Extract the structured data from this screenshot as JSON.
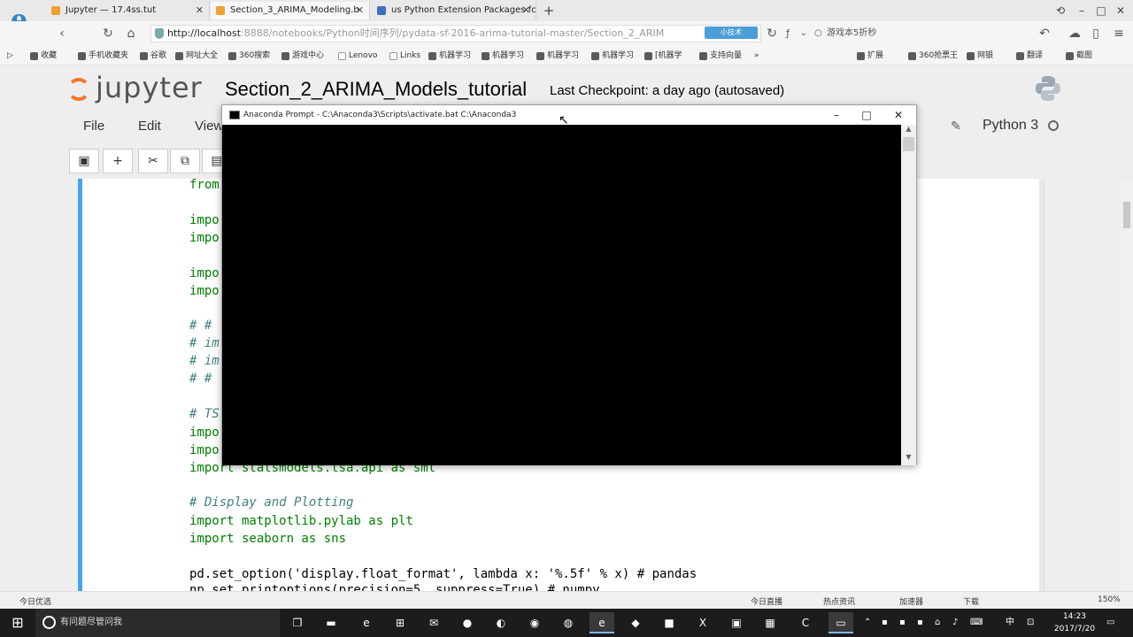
{
  "browser": {
    "tabs": [
      {
        "label": "Jupyter — 17.4ss.tut"
      },
      {
        "label": "Section_3_ARIMA_Modeling.b"
      },
      {
        "label": "us Python Extension Packages fc"
      }
    ],
    "new_tab": "+",
    "url_host": "http://localhost",
    "url_rest": ":8888/notebooks/Python时间序列/pydata-sf-2016-arima-tutorial-master/Section_2_ARIM",
    "url_badge": "小技术",
    "search_text": "游戏本5折秒",
    "bookmarks": [
      "收藏",
      "手机收藏夹",
      "谷歌",
      "网址大全",
      "360搜索",
      "游戏中心",
      "Lenovo",
      "Links",
      "机器学习",
      "机器学习",
      "机器学习",
      "机器学习",
      "[机器学",
      "支持向量"
    ],
    "bookmark_right": [
      "扩展",
      "360抢票王",
      "网银",
      "翻译",
      "截图"
    ]
  },
  "jupyter": {
    "logo_text": "jupyter",
    "notebook_title": "Section_2_ARIMA_Models_tutorial",
    "checkpoint": "Last Checkpoint: a day ago (autosaved)",
    "menu": [
      "File",
      "Edit",
      "View"
    ],
    "kernel": "Python 3",
    "toolbar": {
      "save": "💾",
      "add": "+",
      "cut": "✂",
      "copy": "⧉",
      "paste": "📋"
    },
    "code_lines": [
      {
        "text": "from",
        "type": "kw"
      },
      {
        "text": "impo",
        "type": "kw"
      },
      {
        "text": "impo",
        "type": "kw"
      },
      {
        "text": "impo",
        "type": "kw"
      },
      {
        "text": "impo",
        "type": "kw"
      },
      {
        "text": "# #",
        "type": "comment"
      },
      {
        "text": "# im",
        "type": "comment"
      },
      {
        "text": "# im",
        "type": "comment"
      },
      {
        "text": "# #",
        "type": "comment"
      },
      {
        "text": "# TS",
        "type": "comment"
      },
      {
        "text": "impo",
        "type": "kw"
      },
      {
        "text": "impo",
        "type": "kw"
      },
      {
        "text": "import statsmodels.tsa.api as smt",
        "type": "kw"
      },
      {
        "text": "# Display and Plotting",
        "type": "comment"
      },
      {
        "text": "import matplotlib.pylab as plt",
        "type": "kw"
      },
      {
        "text": "import seaborn as sns",
        "type": "kw"
      },
      {
        "text": "pd.set_option('display.float_format', lambda x: '%.5f' % x) # pandas",
        "type": "plain"
      },
      {
        "text": "np.set_printoptions(precision=5, suppress=True) # numpy",
        "type": "plain"
      }
    ]
  },
  "console": {
    "title": "Anaconda Prompt - C:\\Anaconda3\\Scripts\\activate.bat  C:\\Anaconda3",
    "minimize": "–",
    "maximize": "□",
    "close": "✕"
  },
  "statusbar": {
    "left": "今日优选",
    "items": [
      "今日直播",
      "热点资讯",
      "加速器",
      "下载",
      "150%"
    ]
  },
  "taskbar": {
    "search_placeholder": "有问题尽管问我",
    "time": "14:23",
    "date": "2017/7/20",
    "lang": "中"
  }
}
